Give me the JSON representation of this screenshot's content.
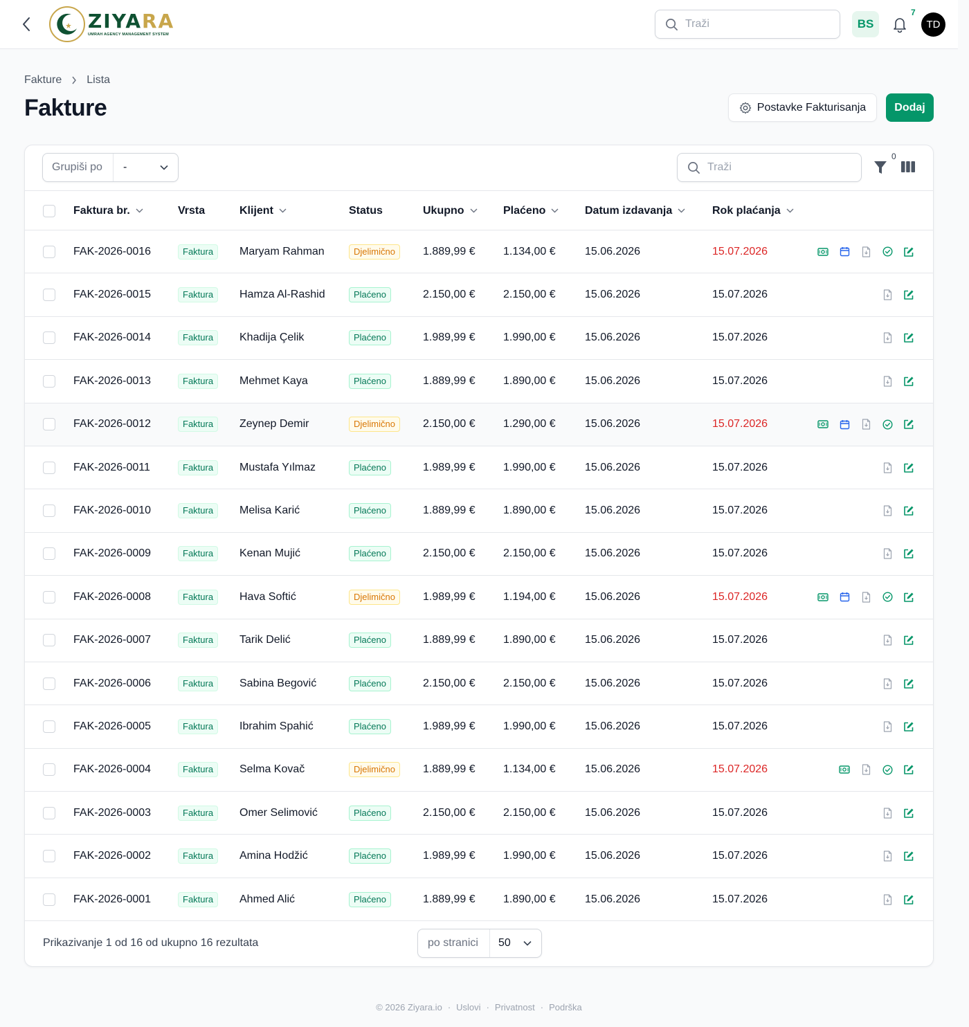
{
  "topbar": {
    "brand": {
      "name_part1": "ZIYA",
      "name_part2": "RA",
      "tagline": "UMRAH AGENCY MANAGEMENT SYSTEM"
    },
    "search_placeholder": "Traži",
    "language": "BS",
    "notification_count": "7",
    "user_initials": "TD"
  },
  "breadcrumb": {
    "parent": "Fakture",
    "current": "Lista"
  },
  "page_title": "Fakture",
  "actions": {
    "settings_label": "Postavke Fakturisanja",
    "add_label": "Dodaj"
  },
  "toolbar": {
    "groupby_label": "Grupiši po",
    "groupby_value": "-",
    "search_placeholder": "Traži",
    "filter_count": "0"
  },
  "columns": {
    "number": "Faktura br.",
    "type": "Vrsta",
    "client": "Klijent",
    "status": "Status",
    "total": "Ukupno",
    "paid": "Plaćeno",
    "issue_date": "Datum izdavanja",
    "due_date": "Rok plaćanja"
  },
  "rows": [
    {
      "number": "FAK-2026-0016",
      "type": "Faktura",
      "client": "Maryam Rahman",
      "status": "Djelimično",
      "status_kind": "partial",
      "total": "1.889,99 €",
      "paid": "1.134,00 €",
      "issue_date": "15.06.2026",
      "due_date": "15.07.2026",
      "overdue": true,
      "actions": [
        "payment",
        "calendar",
        "pdf",
        "check",
        "edit"
      ]
    },
    {
      "number": "FAK-2026-0015",
      "type": "Faktura",
      "client": "Hamza Al-Rashid",
      "status": "Plaćeno",
      "status_kind": "paid",
      "total": "2.150,00 €",
      "paid": "2.150,00 €",
      "issue_date": "15.06.2026",
      "due_date": "15.07.2026",
      "overdue": false,
      "actions": [
        "pdf",
        "edit"
      ]
    },
    {
      "number": "FAK-2026-0014",
      "type": "Faktura",
      "client": "Khadija Çelik",
      "status": "Plaćeno",
      "status_kind": "paid",
      "total": "1.989,99 €",
      "paid": "1.990,00 €",
      "issue_date": "15.06.2026",
      "due_date": "15.07.2026",
      "overdue": false,
      "actions": [
        "pdf",
        "edit"
      ]
    },
    {
      "number": "FAK-2026-0013",
      "type": "Faktura",
      "client": "Mehmet Kaya",
      "status": "Plaćeno",
      "status_kind": "paid",
      "total": "1.889,99 €",
      "paid": "1.890,00 €",
      "issue_date": "15.06.2026",
      "due_date": "15.07.2026",
      "overdue": false,
      "actions": [
        "pdf",
        "edit"
      ]
    },
    {
      "number": "FAK-2026-0012",
      "type": "Faktura",
      "client": "Zeynep Demir",
      "status": "Djelimično",
      "status_kind": "partial",
      "total": "2.150,00 €",
      "paid": "1.290,00 €",
      "issue_date": "15.06.2026",
      "due_date": "15.07.2026",
      "overdue": true,
      "actions": [
        "payment",
        "calendar",
        "pdf",
        "check",
        "edit"
      ]
    },
    {
      "number": "FAK-2026-0011",
      "type": "Faktura",
      "client": "Mustafa Yılmaz",
      "status": "Plaćeno",
      "status_kind": "paid",
      "total": "1.989,99 €",
      "paid": "1.990,00 €",
      "issue_date": "15.06.2026",
      "due_date": "15.07.2026",
      "overdue": false,
      "actions": [
        "pdf",
        "edit"
      ]
    },
    {
      "number": "FAK-2026-0010",
      "type": "Faktura",
      "client": "Melisa Karić",
      "status": "Plaćeno",
      "status_kind": "paid",
      "total": "1.889,99 €",
      "paid": "1.890,00 €",
      "issue_date": "15.06.2026",
      "due_date": "15.07.2026",
      "overdue": false,
      "actions": [
        "pdf",
        "edit"
      ]
    },
    {
      "number": "FAK-2026-0009",
      "type": "Faktura",
      "client": "Kenan Mujić",
      "status": "Plaćeno",
      "status_kind": "paid",
      "total": "2.150,00 €",
      "paid": "2.150,00 €",
      "issue_date": "15.06.2026",
      "due_date": "15.07.2026",
      "overdue": false,
      "actions": [
        "pdf",
        "edit"
      ]
    },
    {
      "number": "FAK-2026-0008",
      "type": "Faktura",
      "client": "Hava Softić",
      "status": "Djelimično",
      "status_kind": "partial",
      "total": "1.989,99 €",
      "paid": "1.194,00 €",
      "issue_date": "15.06.2026",
      "due_date": "15.07.2026",
      "overdue": true,
      "actions": [
        "payment",
        "calendar",
        "pdf",
        "check",
        "edit"
      ]
    },
    {
      "number": "FAK-2026-0007",
      "type": "Faktura",
      "client": "Tarik Delić",
      "status": "Plaćeno",
      "status_kind": "paid",
      "total": "1.889,99 €",
      "paid": "1.890,00 €",
      "issue_date": "15.06.2026",
      "due_date": "15.07.2026",
      "overdue": false,
      "actions": [
        "pdf",
        "edit"
      ]
    },
    {
      "number": "FAK-2026-0006",
      "type": "Faktura",
      "client": "Sabina Begović",
      "status": "Plaćeno",
      "status_kind": "paid",
      "total": "2.150,00 €",
      "paid": "2.150,00 €",
      "issue_date": "15.06.2026",
      "due_date": "15.07.2026",
      "overdue": false,
      "actions": [
        "pdf",
        "edit"
      ]
    },
    {
      "number": "FAK-2026-0005",
      "type": "Faktura",
      "client": "Ibrahim Spahić",
      "status": "Plaćeno",
      "status_kind": "paid",
      "total": "1.989,99 €",
      "paid": "1.990,00 €",
      "issue_date": "15.06.2026",
      "due_date": "15.07.2026",
      "overdue": false,
      "actions": [
        "pdf",
        "edit"
      ]
    },
    {
      "number": "FAK-2026-0004",
      "type": "Faktura",
      "client": "Selma Kovač",
      "status": "Djelimično",
      "status_kind": "partial",
      "total": "1.889,99 €",
      "paid": "1.134,00 €",
      "issue_date": "15.06.2026",
      "due_date": "15.07.2026",
      "overdue": true,
      "actions": [
        "payment",
        "pdf",
        "check",
        "edit"
      ]
    },
    {
      "number": "FAK-2026-0003",
      "type": "Faktura",
      "client": "Omer Selimović",
      "status": "Plaćeno",
      "status_kind": "paid",
      "total": "2.150,00 €",
      "paid": "2.150,00 €",
      "issue_date": "15.06.2026",
      "due_date": "15.07.2026",
      "overdue": false,
      "actions": [
        "pdf",
        "edit"
      ]
    },
    {
      "number": "FAK-2026-0002",
      "type": "Faktura",
      "client": "Amina Hodžić",
      "status": "Plaćeno",
      "status_kind": "paid",
      "total": "1.989,99 €",
      "paid": "1.990,00 €",
      "issue_date": "15.06.2026",
      "due_date": "15.07.2026",
      "overdue": false,
      "actions": [
        "pdf",
        "edit"
      ]
    },
    {
      "number": "FAK-2026-0001",
      "type": "Faktura",
      "client": "Ahmed Alić",
      "status": "Plaćeno",
      "status_kind": "paid",
      "total": "1.889,99 €",
      "paid": "1.890,00 €",
      "issue_date": "15.06.2026",
      "due_date": "15.07.2026",
      "overdue": false,
      "actions": [
        "pdf",
        "edit"
      ]
    }
  ],
  "pagination": {
    "summary": "Prikazivanje 1 od 16 od ukupno 16 rezultata",
    "per_page_label": "po stranici",
    "per_page_value": "50"
  },
  "footer": {
    "copyright": "© 2026 Ziyara.io",
    "links": [
      "Uslovi",
      "Privatnost",
      "Podrška"
    ]
  },
  "colors": {
    "brand_green": "#059669",
    "partial": "#d97706",
    "overdue": "#dc2626",
    "calendar_blue": "#2563eb"
  }
}
